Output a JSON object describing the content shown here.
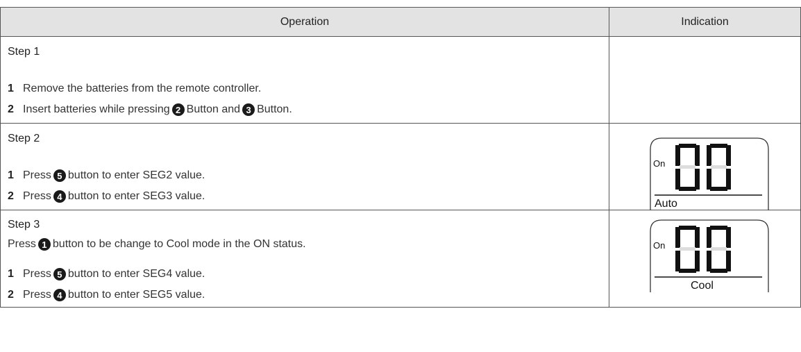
{
  "table": {
    "headers": {
      "operation": "Operation",
      "indication": "Indication"
    },
    "steps": [
      {
        "title": "Step 1",
        "items": [
          {
            "num": "1",
            "text": "Remove the batteries from the remote controller."
          },
          {
            "num": "2",
            "pre": "Insert batteries while pressing",
            "b1": "2",
            "mid": "Button and",
            "b2": "3",
            "post": "Button."
          }
        ]
      },
      {
        "title": "Step 2",
        "items": [
          {
            "num": "1",
            "pre": "Press",
            "b1": "5",
            "post": "button to enter SEG2 value."
          },
          {
            "num": "2",
            "pre": "Press",
            "b1": "4",
            "post": "button to enter SEG3 value."
          }
        ],
        "indication": {
          "on_label": "On",
          "digits": "00",
          "mode": "Auto"
        }
      },
      {
        "title": "Step 3",
        "note": {
          "pre": "Press",
          "b1": "1",
          "post": "button to be change to Cool mode in the ON status."
        },
        "items": [
          {
            "num": "1",
            "pre": "Press",
            "b1": "5",
            "post": "button to enter SEG4 value."
          },
          {
            "num": "2",
            "pre": "Press",
            "b1": "4",
            "post": "button to enter SEG5 value."
          }
        ],
        "indication": {
          "on_label": "On",
          "digits": "00",
          "mode": "Cool"
        }
      }
    ]
  }
}
